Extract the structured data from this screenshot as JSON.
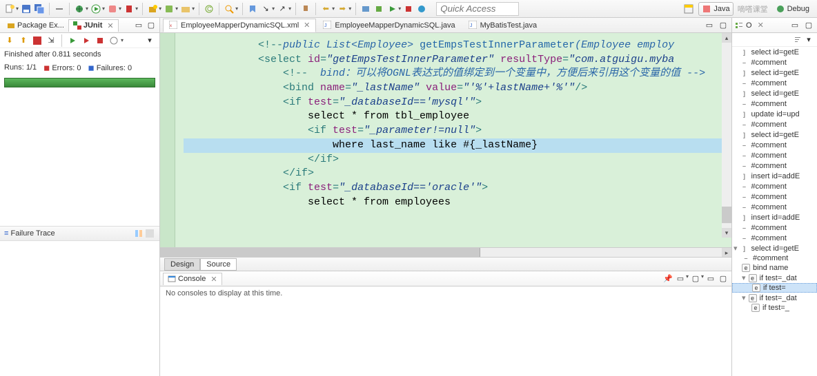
{
  "toolbar": {
    "quick_access_placeholder": "Quick Access"
  },
  "perspectives": {
    "java": "Java",
    "junit_hint": "嘀嗒课堂",
    "debug": "Debug"
  },
  "left": {
    "package_explorer_tab": "Package Ex...",
    "junit_tab": "JUnit",
    "status": "Finished after 0.811 seconds",
    "runs_label": "Runs:",
    "runs_value": "1/1",
    "errors_icon": "◼",
    "errors_label": "Errors:",
    "errors_value": "0",
    "failures_icon": "◼",
    "failures_label": "Failures:",
    "failures_value": "0",
    "failure_trace": "Failure Trace"
  },
  "editor": {
    "tabs": [
      {
        "name": "EmployeeMapperDynamicSQL.xml",
        "active": true
      },
      {
        "name": "EmployeeMapperDynamicSQL.java",
        "active": false
      },
      {
        "name": "MyBatisTest.java",
        "active": false
      }
    ],
    "code_lines": [
      {
        "indent": 3,
        "html": "<span class='tag'>&lt;!--</span><span class='cm'>public List&lt;Employee&gt; </span><span class='meth'>getEmpsTestInnerParameter</span><span class='cm'>(Employee employ</span>"
      },
      {
        "indent": 3,
        "html": "<span class='tag'>&lt;select </span><span class='attr-red'>id</span><span class='tag'>=</span><span class='attr-blue'>\"getEmpsTestInnerParameter\"</span> <span class='attr-red'>resultType</span><span class='tag'>=</span><span class='attr-blue'>\"com.atguigu.myba</span>"
      },
      {
        "indent": 4,
        "html": "<span class='tag'>&lt;!-- </span><span class='cm'> bind：可以将OGNL表达式的值绑定到一个变量中，方便后来引用这个变量的值 --&gt;</span>"
      },
      {
        "indent": 4,
        "html": "<span class='tag'>&lt;bind </span><span class='attr-red'>name</span><span class='tag'>=</span><span class='attr-blue'>\"_lastName\"</span> <span class='attr-red'>value</span><span class='tag'>=</span><span class='attr-blue'>\"'%'+lastName+'%'\"</span><span class='tag'>/&gt;</span>"
      },
      {
        "indent": 4,
        "html": "<span class='tag'>&lt;if </span><span class='attr-red'>test</span><span class='tag'>=</span><span class='attr-blue'>\"_databaseId=='mysql'\"</span><span class='tag'>&gt;</span>"
      },
      {
        "indent": 5,
        "html": "select * from tbl_employee"
      },
      {
        "indent": 5,
        "html": "<span class='tag'>&lt;if </span><span class='attr-red'>test</span><span class='tag'>=</span><span class='attr-blue'>\"_parameter!=null\"</span><span class='tag'>&gt;</span>"
      },
      {
        "indent": 6,
        "html": "where last_name like #{_lastName}",
        "hl": true
      },
      {
        "indent": 5,
        "html": "<span class='tag'>&lt;/if&gt;</span>"
      },
      {
        "indent": 4,
        "html": "<span class='tag'>&lt;/if&gt;</span>"
      },
      {
        "indent": 4,
        "html": "<span class='tag'>&lt;if </span><span class='attr-red'>test</span><span class='tag'>=</span><span class='attr-blue'>\"_databaseId=='oracle'\"</span><span class='tag'>&gt;</span>"
      },
      {
        "indent": 5,
        "html": "select * from employees"
      }
    ],
    "design_tab": "Design",
    "source_tab": "Source"
  },
  "console": {
    "tab": "Console",
    "body": "No consoles to display at this time."
  },
  "outline": {
    "items": [
      {
        "lv": 0,
        "icon": "bracket",
        "text": "select id=getE"
      },
      {
        "lv": 0,
        "icon": "dash",
        "text": "#comment"
      },
      {
        "lv": 0,
        "icon": "bracket",
        "text": "select id=getE"
      },
      {
        "lv": 0,
        "icon": "dash",
        "text": "#comment"
      },
      {
        "lv": 0,
        "icon": "bracket",
        "text": "select id=getE"
      },
      {
        "lv": 0,
        "icon": "dash",
        "text": "#comment"
      },
      {
        "lv": 0,
        "icon": "bracket",
        "text": "update id=upd"
      },
      {
        "lv": 0,
        "icon": "dash",
        "text": "#comment"
      },
      {
        "lv": 0,
        "icon": "bracket",
        "text": "select id=getE"
      },
      {
        "lv": 0,
        "icon": "dash",
        "text": "#comment"
      },
      {
        "lv": 0,
        "icon": "dash",
        "text": "#comment"
      },
      {
        "lv": 0,
        "icon": "dash",
        "text": "#comment"
      },
      {
        "lv": 0,
        "icon": "bracket",
        "text": "insert id=addE"
      },
      {
        "lv": 0,
        "icon": "dash",
        "text": "#comment"
      },
      {
        "lv": 0,
        "icon": "dash",
        "text": "#comment"
      },
      {
        "lv": 0,
        "icon": "dash",
        "text": "#comment"
      },
      {
        "lv": 0,
        "icon": "bracket",
        "text": "insert id=addE"
      },
      {
        "lv": 0,
        "icon": "dash",
        "text": "#comment"
      },
      {
        "lv": 0,
        "icon": "dash",
        "text": "#comment"
      },
      {
        "lv": 0,
        "icon": "bracket",
        "text": "select id=getE",
        "exp": true
      },
      {
        "lv": 1,
        "icon": "dash",
        "text": "#comment"
      },
      {
        "lv": 1,
        "icon": "e",
        "text": "bind name"
      },
      {
        "lv": 1,
        "icon": "e",
        "text": "if test=_dat",
        "exp": true
      },
      {
        "lv": 2,
        "icon": "e",
        "text": "if test=",
        "sel": true
      },
      {
        "lv": 1,
        "icon": "e",
        "text": "if test=_dat",
        "exp": true
      },
      {
        "lv": 2,
        "icon": "e",
        "text": "if test=_"
      }
    ]
  }
}
